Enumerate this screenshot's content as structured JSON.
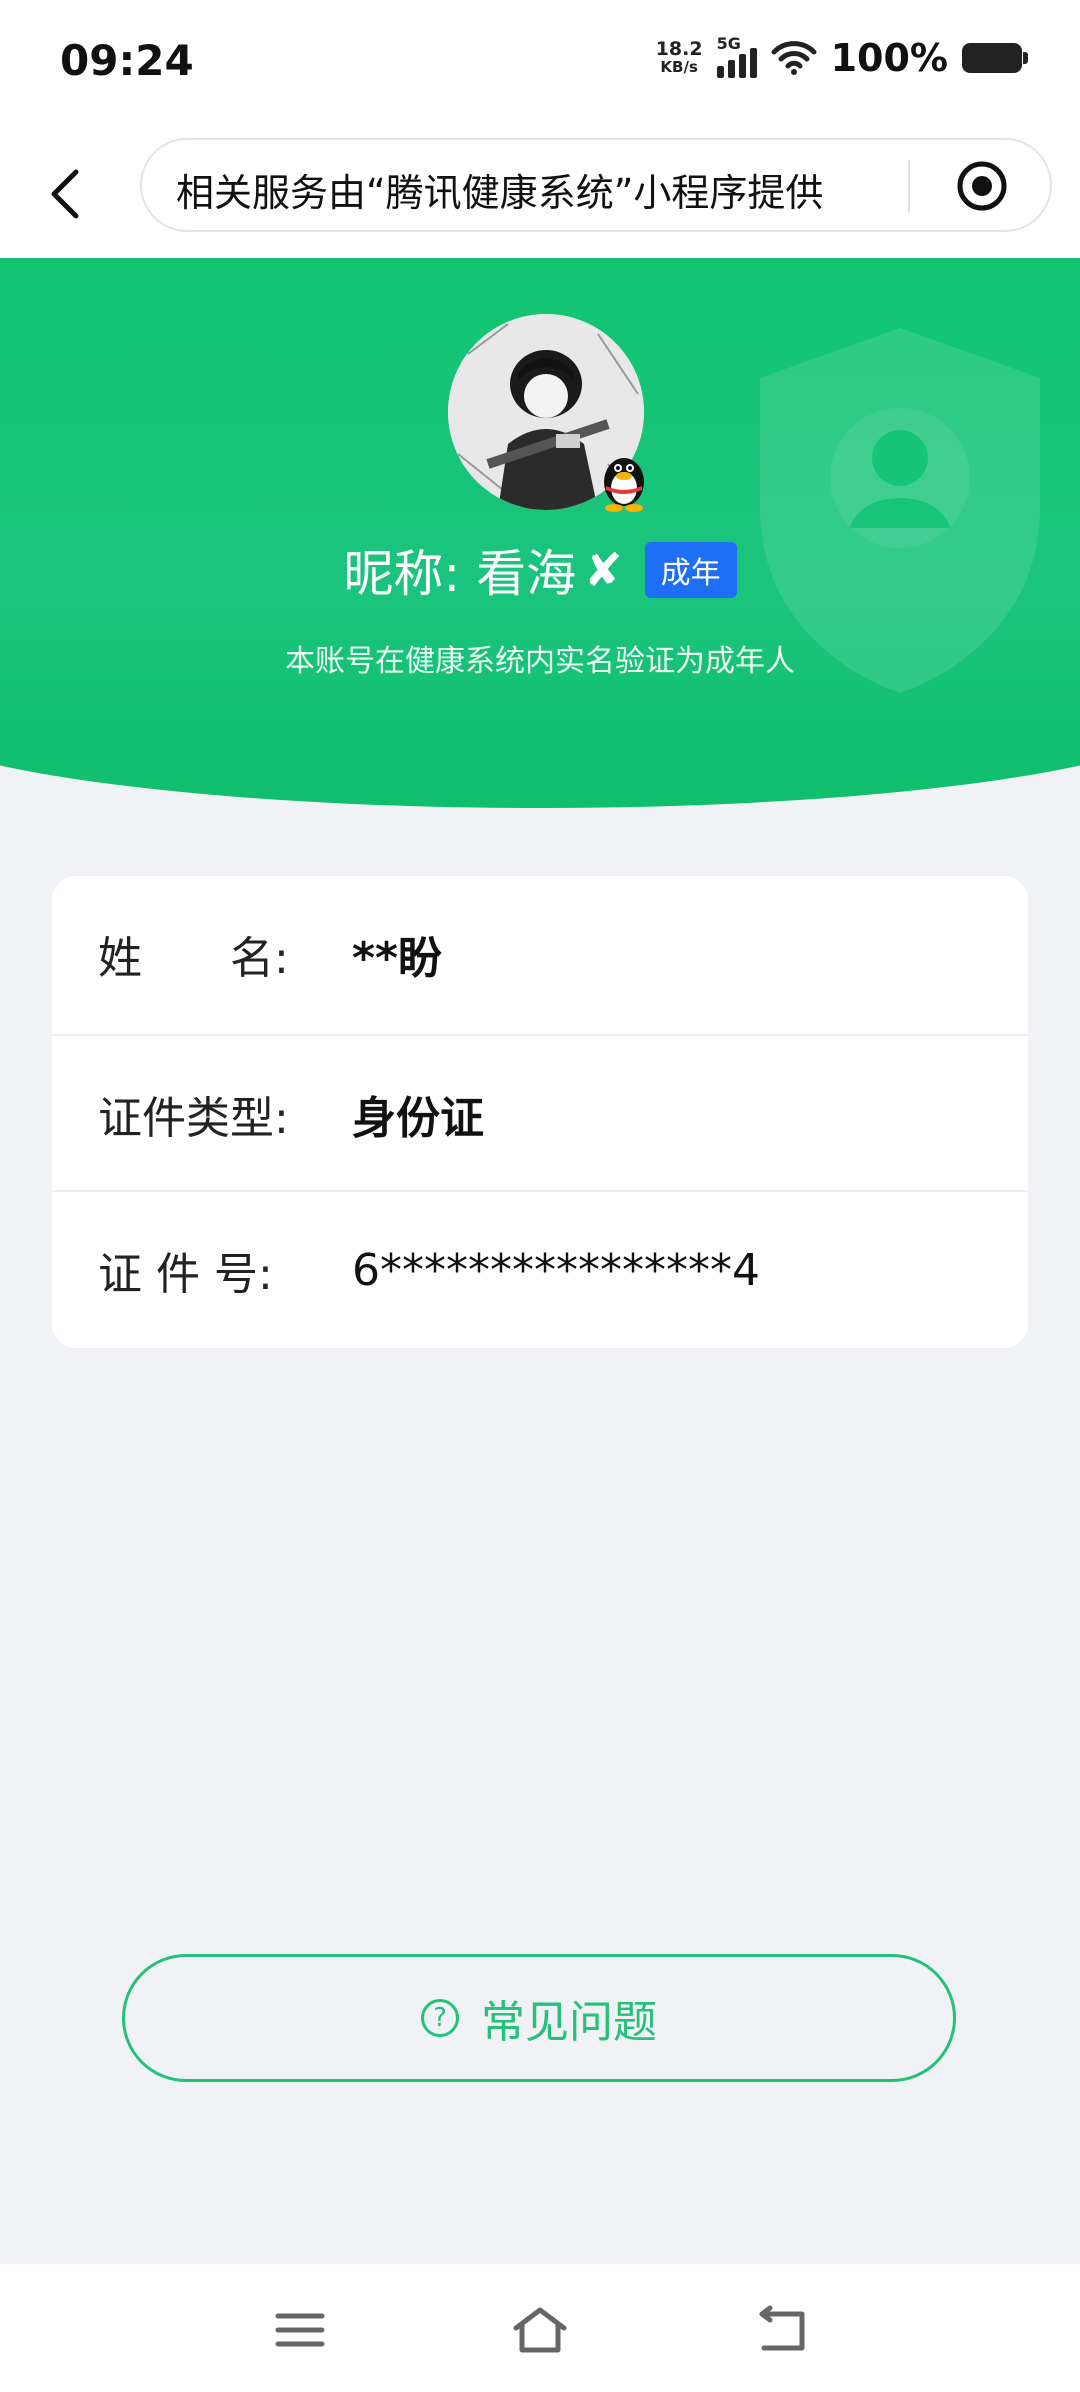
{
  "status_bar": {
    "time": "09:24",
    "net_speed_value": "18.2",
    "net_speed_unit": "KB/s",
    "network": "5G",
    "battery": "100%"
  },
  "nav": {
    "title": "相关服务由“腾讯健康系统”小程序提供",
    "back_icon": "chevron-left-icon",
    "menu_icon": "target-icon"
  },
  "profile": {
    "nickname": "昵称: 看海",
    "verified_mark": "✘",
    "badge": "成年",
    "subtitle": "本账号在健康系统内实名验证为成年人",
    "accent_color": "#12c473"
  },
  "info": {
    "rows": [
      {
        "label": "姓　　名:",
        "value": "**盼"
      },
      {
        "label": "证件类型:",
        "value": "身份证"
      },
      {
        "label": "证 件 号:",
        "value": "6****************4"
      }
    ]
  },
  "faq": {
    "icon": "question-circle-icon",
    "label": "常见问题"
  },
  "system_nav": {
    "menu_icon": "menu-icon",
    "home_icon": "home-icon",
    "back_icon": "back-icon"
  }
}
